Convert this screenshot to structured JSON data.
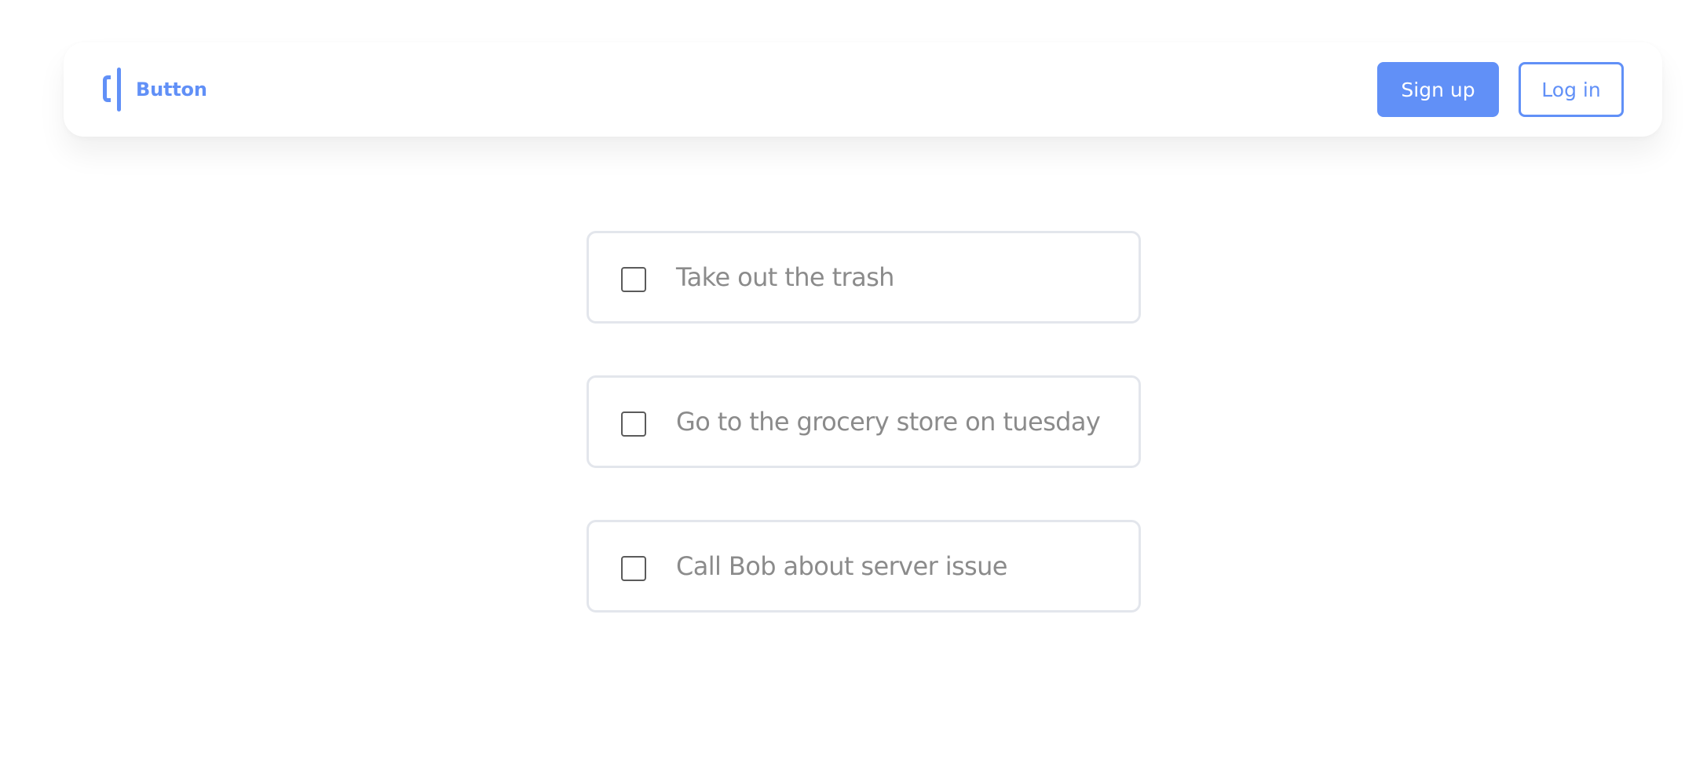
{
  "navbar": {
    "logo_text": "Button",
    "signup_label": "Sign up",
    "login_label": "Log in"
  },
  "todos": [
    {
      "label": "Take out the trash",
      "checked": false
    },
    {
      "label": "Go to the grocery store on tuesday",
      "checked": false
    },
    {
      "label": "Call Bob about server issue",
      "checked": false
    }
  ],
  "colors": {
    "accent": "#6190f7",
    "text_muted": "#8b8b8b",
    "border": "#e3e6ec"
  }
}
